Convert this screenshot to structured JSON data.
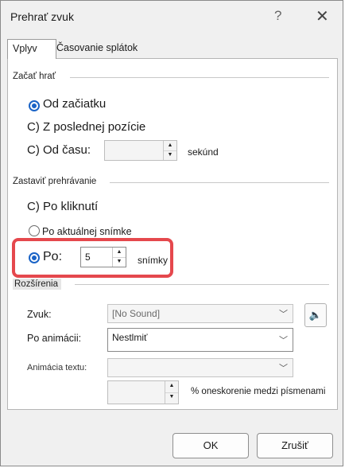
{
  "window": {
    "title": "Prehrať zvuk",
    "help_glyph": "?",
    "close_glyph": "✕"
  },
  "tabs": [
    {
      "label": "Vplyv"
    },
    {
      "label": "Časovanie splátok"
    }
  ],
  "start": {
    "heading": "Začať hrať",
    "options": [
      {
        "label": "Od začiatku",
        "selected": true
      },
      {
        "label": "C) Z poslednej pozície",
        "selected": false
      },
      {
        "label": "C) Od času:",
        "selected": false
      }
    ],
    "time_unit": "sekúnd",
    "time_value": ""
  },
  "stop": {
    "heading": "Zastaviť prehrávanie",
    "options": [
      {
        "label": "C) Po kliknutí",
        "selected": false
      },
      {
        "label": "Po aktuálnej snímke",
        "selected": false
      },
      {
        "label": "Po:",
        "selected": true
      }
    ],
    "after_value": "5",
    "after_unit": "snímky"
  },
  "enhancements": {
    "heading": "Rozšírenia",
    "sound_label": "Zvuk:",
    "sound_value": "[No Sound]",
    "after_anim_label": "Po animácii:",
    "after_anim_value": "Nestlmiť",
    "text_anim_label": "Animácia textu:",
    "text_anim_value": "",
    "delay_value": "",
    "delay_unit": "% oneskorenie medzi písmenami"
  },
  "buttons": {
    "ok": "OK",
    "cancel": "Zrušiť"
  },
  "colors": {
    "accent": "#1a63c6",
    "highlight": "#e5484d"
  },
  "icons": {
    "speaker": "speaker-icon"
  }
}
